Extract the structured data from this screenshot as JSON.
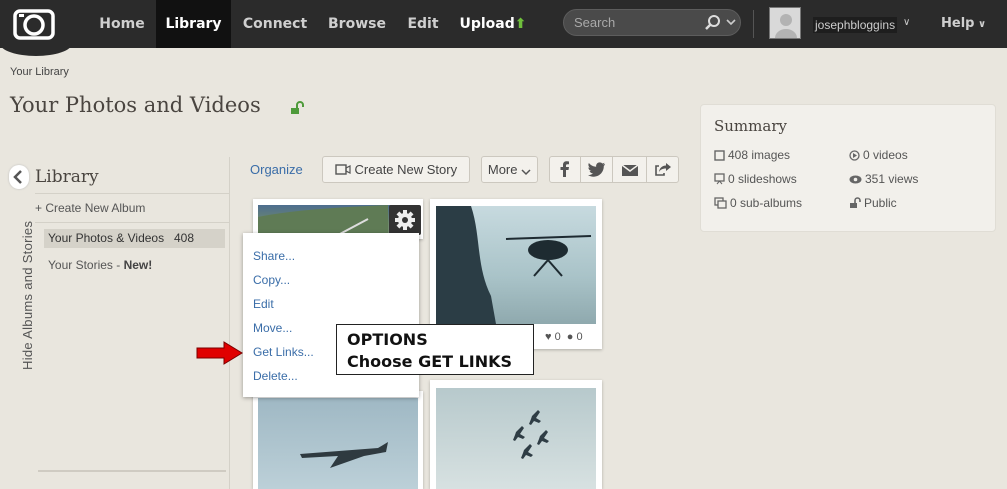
{
  "nav": {
    "home": "Home",
    "library": "Library",
    "connect": "Connect",
    "browse": "Browse",
    "edit": "Edit",
    "upload": "Upload",
    "search_placeholder": "Search",
    "username": "josephbloggins",
    "help": "Help"
  },
  "breadcrumb": "Your Library",
  "page_title": "Your Photos and Videos",
  "summary": {
    "title": "Summary",
    "images": "408 images",
    "videos": "0 videos",
    "slideshows": "0 slideshows",
    "views": "351 views",
    "sub_albums": "0 sub-albums",
    "privacy": "Public"
  },
  "sidebar": {
    "toggle_label": "Hide Albums and Stories",
    "title": "Library",
    "create_album": "+ Create New Album",
    "items": [
      {
        "label": "Your Photos & Videos",
        "count": "408"
      },
      {
        "label": "Your Stories - ",
        "badge": "New!"
      }
    ]
  },
  "toolbar": {
    "organize": "Organize",
    "create_story": "Create New Story",
    "more": "More"
  },
  "context_menu": [
    "Share...",
    "Copy...",
    "Edit",
    "Move...",
    "Get Links...",
    "Delete..."
  ],
  "tile_stats": {
    "likes": "0",
    "comments": "0"
  },
  "callout": {
    "line1": "OPTIONS",
    "line2": "Choose GET LINKS"
  },
  "colors": {
    "topbar": "#2b2b2b",
    "link": "#3a6da8",
    "upload_arrow": "#6fbf3c",
    "annotation_arrow": "#e00000"
  }
}
